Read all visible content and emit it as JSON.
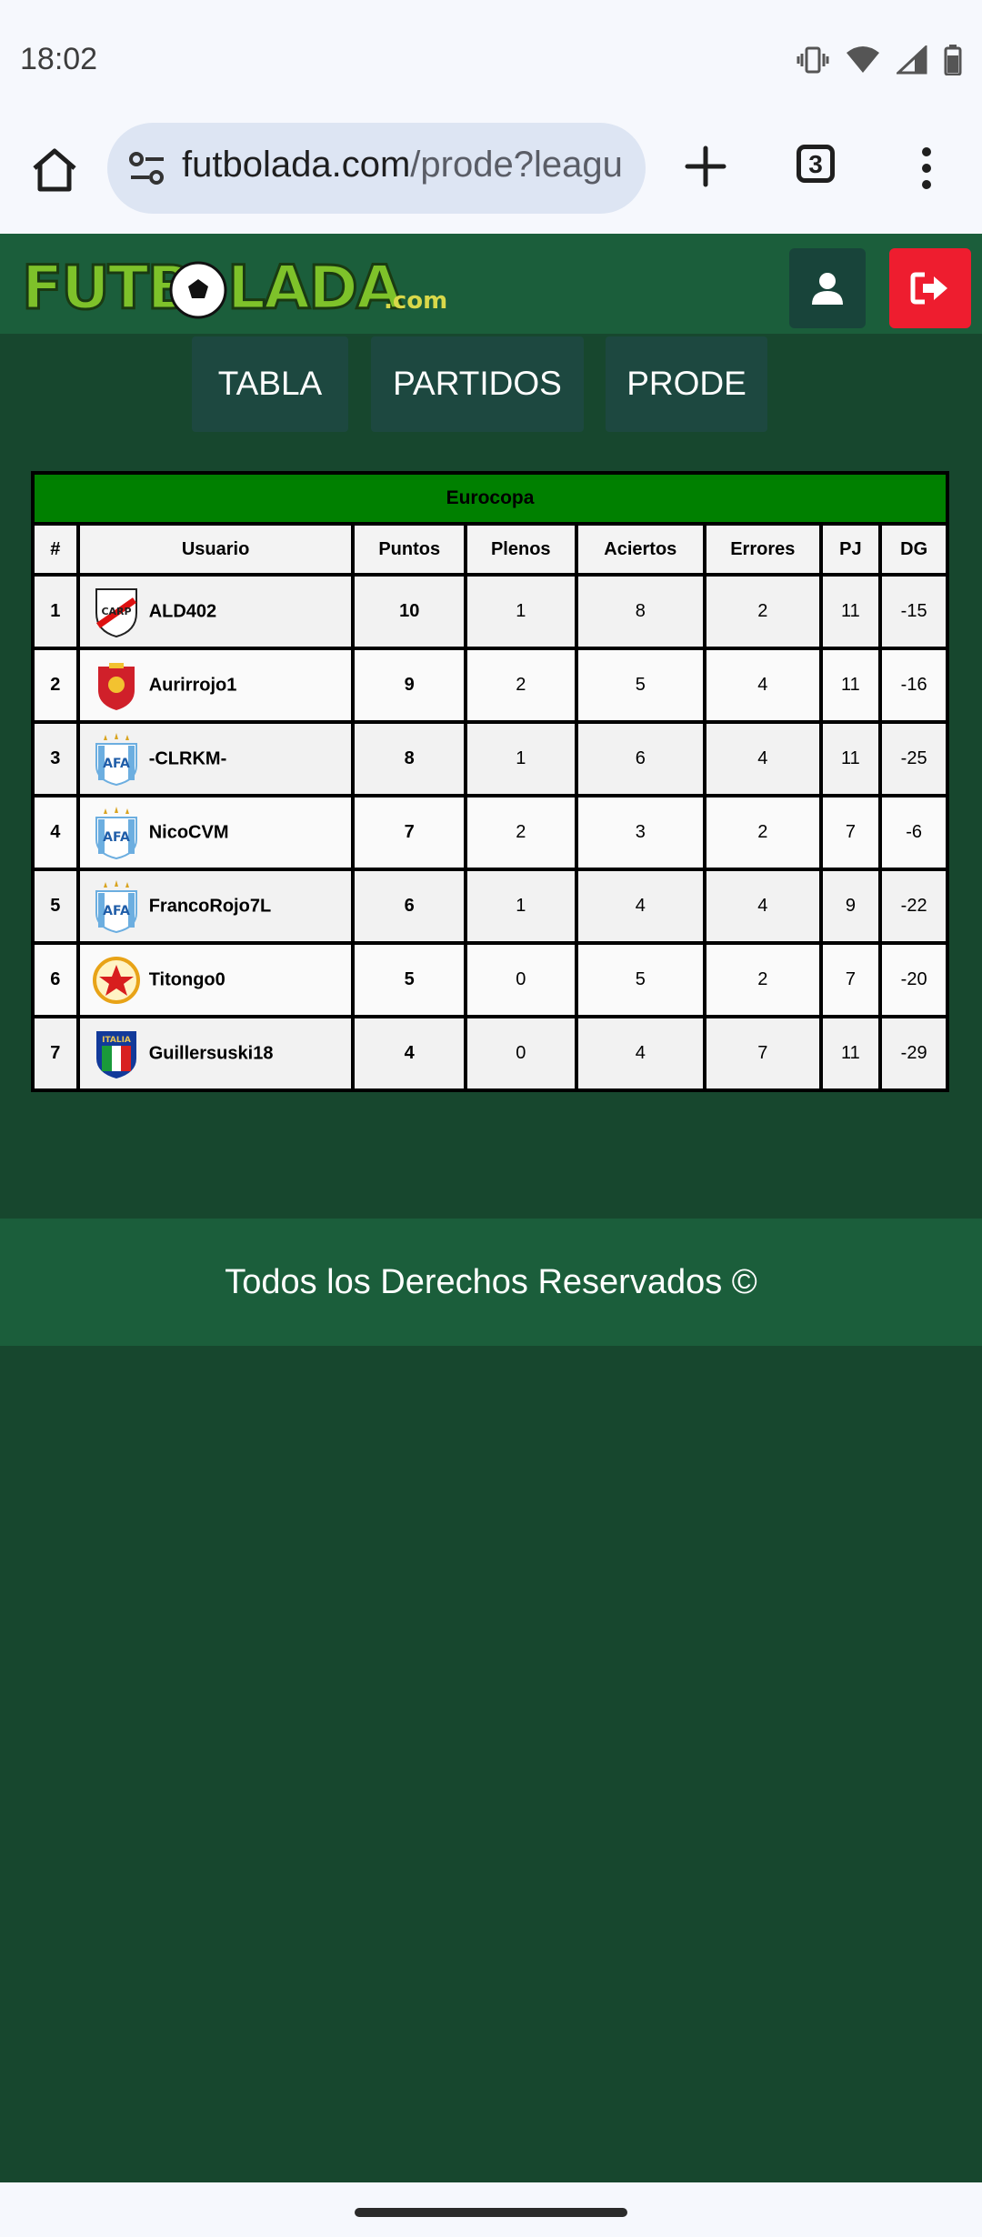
{
  "status_bar": {
    "time": "18:02",
    "icons": [
      "vibrate-icon",
      "wifi-icon",
      "signal-icon",
      "battery-icon"
    ]
  },
  "browser": {
    "url_domain": "futbolada.com",
    "url_path": "/prode?leagu",
    "tab_count": "3"
  },
  "site": {
    "logo_text": "FUTBOLADA.com",
    "colors": {
      "header": "#1b5e3b",
      "logout": "#ee1d2f",
      "table_caption": "#008000"
    }
  },
  "nav": {
    "tabs": [
      {
        "label": "TABLA"
      },
      {
        "label": "PARTIDOS"
      },
      {
        "label": "PRODE"
      }
    ]
  },
  "table": {
    "caption": "Eurocopa",
    "headers": [
      "#",
      "Usuario",
      "Puntos",
      "Plenos",
      "Aciertos",
      "Errores",
      "PJ",
      "DG"
    ],
    "rows": [
      {
        "pos": "1",
        "badge": "river-plate-badge",
        "user": "ALD402",
        "puntos": "10",
        "plenos": "1",
        "aciertos": "8",
        "errores": "2",
        "pj": "11",
        "dg": "-15"
      },
      {
        "pos": "2",
        "badge": "spain-badge",
        "user": "Aurirrojo1",
        "puntos": "9",
        "plenos": "2",
        "aciertos": "5",
        "errores": "4",
        "pj": "11",
        "dg": "-16"
      },
      {
        "pos": "3",
        "badge": "afa-badge",
        "user": "-CLRKM-",
        "puntos": "8",
        "plenos": "1",
        "aciertos": "6",
        "errores": "4",
        "pj": "11",
        "dg": "-25"
      },
      {
        "pos": "4",
        "badge": "afa-badge",
        "user": "NicoCVM",
        "puntos": "7",
        "plenos": "2",
        "aciertos": "3",
        "errores": "2",
        "pj": "7",
        "dg": "-6"
      },
      {
        "pos": "5",
        "badge": "afa-badge",
        "user": "FrancoRojo7L",
        "puntos": "6",
        "plenos": "1",
        "aciertos": "4",
        "errores": "4",
        "pj": "9",
        "dg": "-22"
      },
      {
        "pos": "6",
        "badge": "star-badge",
        "user": "Titongo0",
        "puntos": "5",
        "plenos": "0",
        "aciertos": "5",
        "errores": "2",
        "pj": "7",
        "dg": "-20"
      },
      {
        "pos": "7",
        "badge": "italia-badge",
        "user": "Guillersuski18",
        "puntos": "4",
        "plenos": "0",
        "aciertos": "4",
        "errores": "7",
        "pj": "11",
        "dg": "-29"
      }
    ]
  },
  "footer": {
    "text": "Todos los Derechos Reservados ©"
  }
}
